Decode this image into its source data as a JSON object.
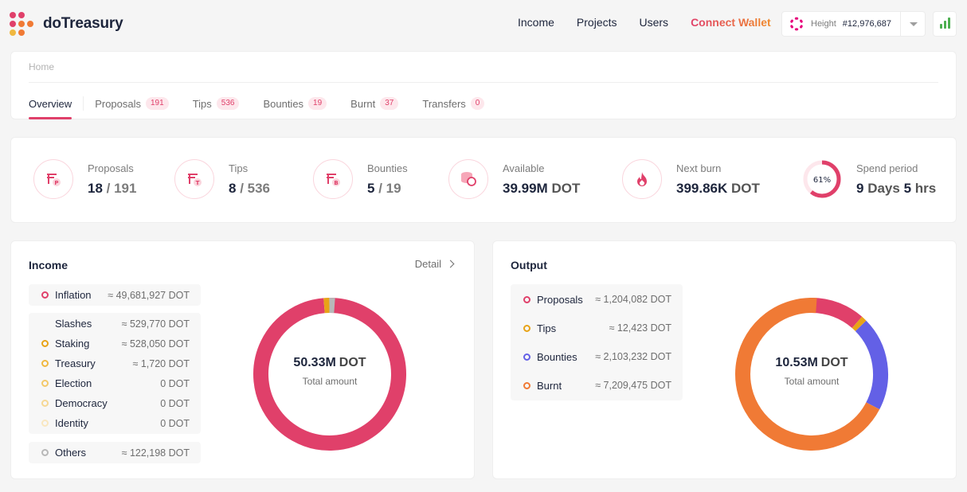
{
  "header": {
    "brand": "doTreasury",
    "nav": [
      {
        "label": "Income"
      },
      {
        "label": "Projects"
      },
      {
        "label": "Users"
      },
      {
        "label": "Connect Wallet"
      }
    ],
    "chain": {
      "height_label": "Height",
      "height_value": "#12,976,687",
      "icon": "polkadot-icon"
    },
    "accent_color": "#e0406a"
  },
  "breadcrumb": "Home",
  "tabs": [
    {
      "label": "Overview",
      "count": ""
    },
    {
      "label": "Proposals",
      "count": "191"
    },
    {
      "label": "Tips",
      "count": "536"
    },
    {
      "label": "Bounties",
      "count": "19"
    },
    {
      "label": "Burnt",
      "count": "37"
    },
    {
      "label": "Transfers",
      "count": "0"
    }
  ],
  "stats": {
    "proposals": {
      "title": "Proposals",
      "a": "18",
      "sep": " / ",
      "b": "191",
      "icon_letter": "P"
    },
    "tips": {
      "title": "Tips",
      "a": "8",
      "sep": " / ",
      "b": "536",
      "icon_letter": "T"
    },
    "bounties": {
      "title": "Bounties",
      "a": "5",
      "sep": " / ",
      "b": "19",
      "icon_letter": "B"
    },
    "available": {
      "title": "Available",
      "value": "39.99M",
      "unit": "DOT"
    },
    "next_burn": {
      "title": "Next burn",
      "value": "399.86K",
      "unit": "DOT"
    },
    "spend_period": {
      "title": "Spend period",
      "percent_label": "61%",
      "percent": 61,
      "d": "9",
      "d_unit": "Days",
      "h": "5",
      "h_unit": "hrs"
    }
  },
  "income": {
    "title": "Income",
    "detail": "Detail",
    "inflation": {
      "name": "Inflation",
      "value": "≈ 49,681,927 DOT",
      "color": "#e0406a"
    },
    "slashes_header": {
      "name": "Slashes",
      "value": "≈ 529,770 DOT"
    },
    "slashes": [
      {
        "name": "Staking",
        "value": "≈ 528,050 DOT",
        "color": "#e8a317"
      },
      {
        "name": "Treasury",
        "value": "≈ 1,720 DOT",
        "color": "#f0b840"
      },
      {
        "name": "Election",
        "value": "0 DOT",
        "color": "#f3c96a"
      },
      {
        "name": "Democracy",
        "value": "0 DOT",
        "color": "#f6d895"
      },
      {
        "name": "Identity",
        "value": "0 DOT",
        "color": "#f9e7c0"
      }
    ],
    "others": {
      "name": "Others",
      "value": "≈ 122,198 DOT",
      "color": "#b8b8b8"
    },
    "total_value": "50.33M",
    "total_unit": "DOT",
    "total_label": "Total amount"
  },
  "output": {
    "title": "Output",
    "items": [
      {
        "name": "Proposals",
        "value": "≈ 1,204,082 DOT",
        "color": "#e0406a"
      },
      {
        "name": "Tips",
        "value": "≈ 12,423 DOT",
        "color": "#e8a317"
      },
      {
        "name": "Bounties",
        "value": "≈ 2,103,232 DOT",
        "color": "#6360e6"
      },
      {
        "name": "Burnt",
        "value": "≈ 7,209,475 DOT",
        "color": "#f07a35"
      }
    ],
    "total_value": "10.53M",
    "total_unit": "DOT",
    "total_label": "Total amount"
  },
  "chart_data": [
    {
      "type": "pie",
      "categories": [
        "Inflation",
        "Slashes",
        "Others"
      ],
      "values": [
        49681927,
        529770,
        122198
      ],
      "colors": [
        "#e0406a",
        "#e8a317",
        "#b8b8b8"
      ]
    },
    {
      "type": "pie",
      "categories": [
        "Proposals",
        "Tips",
        "Bounties",
        "Burnt"
      ],
      "values": [
        1204082,
        12423,
        2103232,
        7209475
      ],
      "colors": [
        "#e0406a",
        "#e8a317",
        "#6360e6",
        "#f07a35"
      ]
    }
  ]
}
